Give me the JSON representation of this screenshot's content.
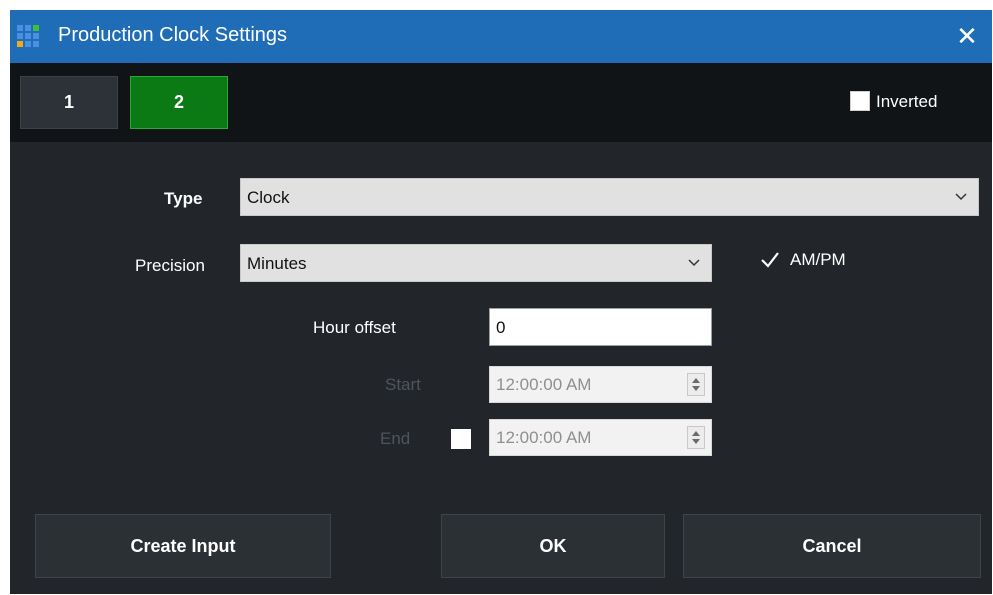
{
  "window": {
    "title": "Production Clock Settings",
    "close_glyph": "✕"
  },
  "tabs": [
    {
      "label": "1",
      "active": false
    },
    {
      "label": "2",
      "active": true
    }
  ],
  "inverted": {
    "label": "Inverted",
    "checked": false
  },
  "type_field": {
    "label": "Type",
    "value": "Clock"
  },
  "precision_field": {
    "label": "Precision",
    "value": "Minutes"
  },
  "ampm": {
    "label": "AM/PM",
    "checked": true
  },
  "hour_offset": {
    "label": "Hour offset",
    "value": "0"
  },
  "start": {
    "label": "Start",
    "value": "12:00:00 AM",
    "enabled": false
  },
  "end": {
    "label": "End",
    "value": "12:00:00 AM",
    "enabled": false,
    "checked": false
  },
  "buttons": {
    "create_input": "Create Input",
    "ok": "OK",
    "cancel": "Cancel"
  },
  "colors": {
    "titlebar": "#1f6cb7",
    "background": "#22262a",
    "tabbar": "#111416",
    "active_tab": "#0c7a14"
  },
  "icons": {
    "app": "vmix-grid-icon",
    "close": "close-icon",
    "dropdown": "chevron-down-icon",
    "spinner": "spinner-arrows-icon",
    "check": "checkmark-icon"
  }
}
